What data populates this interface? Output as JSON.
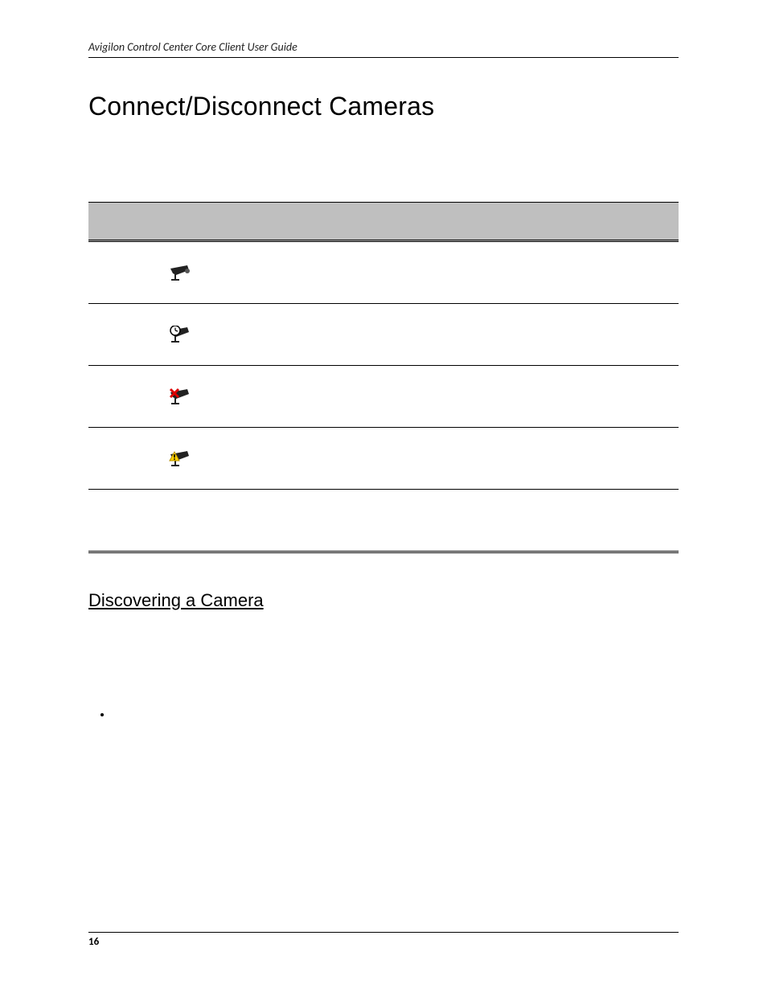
{
  "header": {
    "running_title": "Avigilon Control Center Core Client User Guide"
  },
  "main": {
    "h1": "Connect/Disconnect Cameras",
    "h2": "Discovering a Camera",
    "table": {
      "rows": [
        {
          "icon": "camera-icon",
          "desc": ""
        },
        {
          "icon": "camera-clock-icon",
          "desc": ""
        },
        {
          "icon": "camera-x-icon",
          "desc": ""
        },
        {
          "icon": "camera-warning-icon",
          "desc": ""
        },
        {
          "icon": "",
          "desc": ""
        }
      ]
    },
    "bullets": [
      ""
    ]
  },
  "footer": {
    "page_number": "16"
  }
}
